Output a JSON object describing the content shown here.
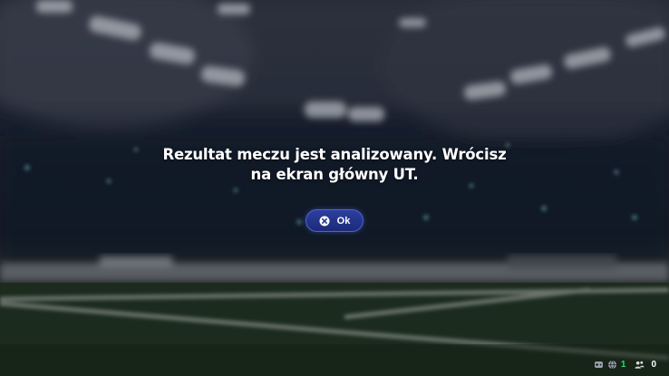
{
  "dialog": {
    "message_line1": "Rezultat meczu jest analizowany. Wrócisz",
    "message_line2": "na ekran główny UT.",
    "ok_label": "Ok",
    "ok_icon": "close-circle-icon"
  },
  "status_bar": {
    "online_count": "1",
    "friends_count": "0",
    "icons": [
      "controller-icon",
      "globe-icon",
      "friends-icon"
    ]
  },
  "colors": {
    "button_fill": "#22318a",
    "button_border": "#4c63d6",
    "online_green": "#35d46a",
    "text": "#ffffff"
  }
}
